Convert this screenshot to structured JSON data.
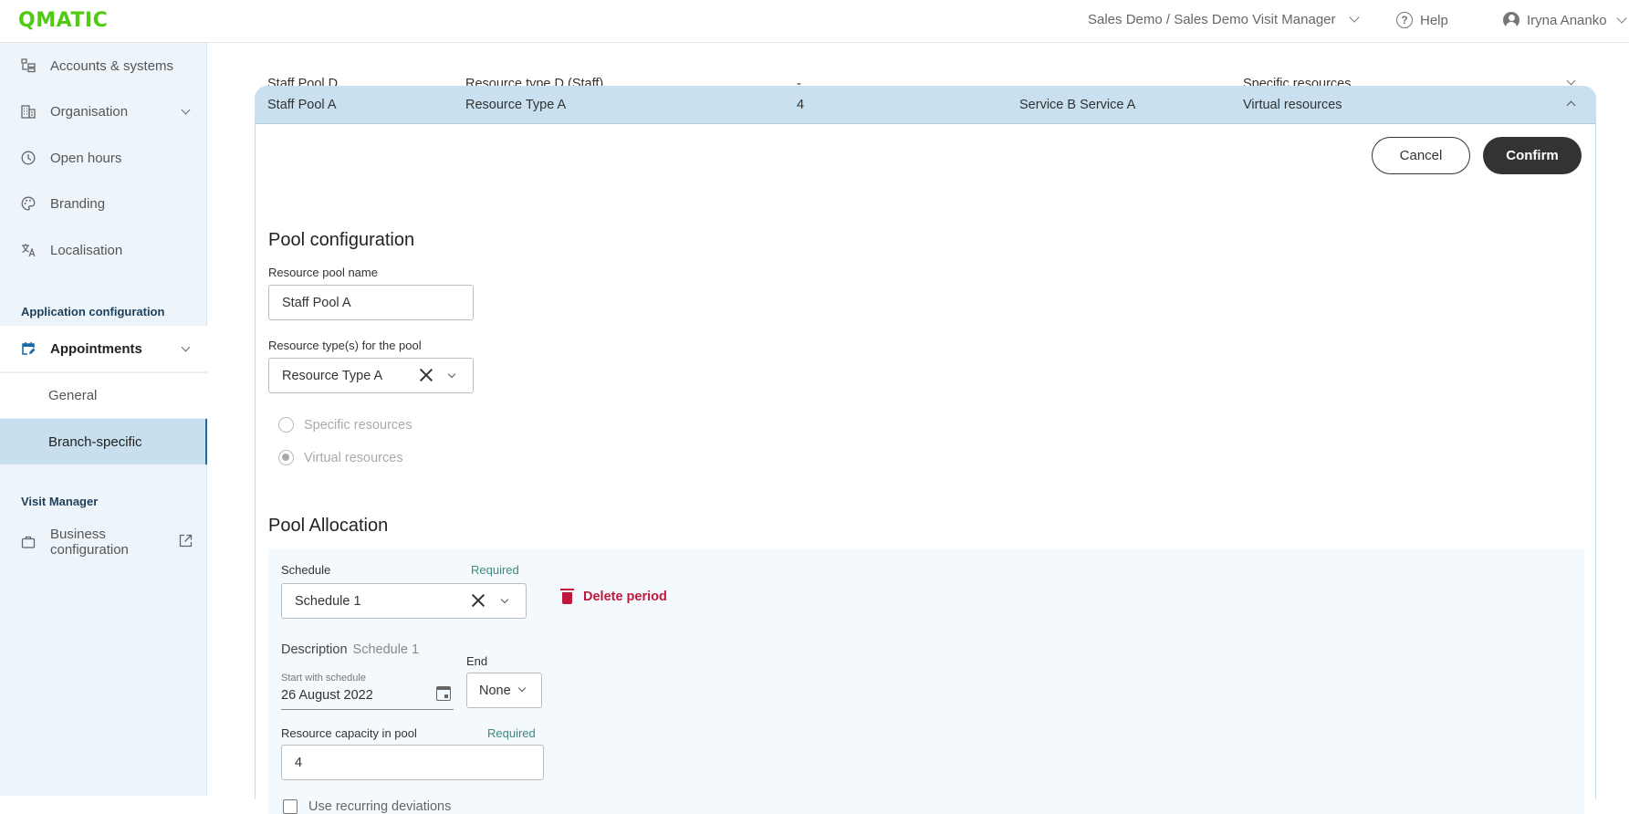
{
  "header": {
    "logo": "QMATIC",
    "breadcrumb": "Sales Demo / Sales Demo Visit Manager",
    "help_label": "Help",
    "user_name": "Iryna Ananko",
    "brand_color": "#4fcb10"
  },
  "sidebar": {
    "items": [
      {
        "label": "Accounts & systems",
        "icon": "accounts-icon"
      },
      {
        "label": "Organisation",
        "icon": "building-icon"
      },
      {
        "label": "Open hours",
        "icon": "clock-icon"
      },
      {
        "label": "Branding",
        "icon": "palette-icon"
      },
      {
        "label": "Localisation",
        "icon": "translate-icon"
      }
    ],
    "section_app": "Application configuration",
    "appointments": "Appointments",
    "sub_items": [
      {
        "label": "General"
      },
      {
        "label": "Branch-specific"
      }
    ],
    "section_vm": "Visit Manager",
    "business_config": "Business configuration"
  },
  "pools": {
    "rows": [
      {
        "name": "Staff Pool D",
        "type": "Resource type D (Staff)",
        "capacity": "-",
        "services": "",
        "mode": "Specific resources"
      },
      {
        "name": "Staff Pool A",
        "type": "Resource Type A",
        "capacity": "4",
        "services": "Service B Service A",
        "mode": "Virtual resources"
      }
    ]
  },
  "editor": {
    "cancel_label": "Cancel",
    "confirm_label": "Confirm",
    "config_title": "Pool configuration",
    "pool_name_label": "Resource pool name",
    "pool_name_value": "Staff Pool A",
    "resource_type_label": "Resource type(s) for the pool",
    "resource_type_value": "Resource Type A",
    "radio_specific": "Specific resources",
    "radio_virtual": "Virtual resources",
    "radio_selected": "Virtual resources",
    "allocation_title": "Pool Allocation",
    "schedule_label": "Schedule",
    "required_label": "Required",
    "schedule_value": "Schedule 1",
    "delete_period": "Delete period",
    "description_label": "Description",
    "description_value": "Schedule 1",
    "start_label": "Start with schedule",
    "start_value": "26 August 2022",
    "end_label": "End",
    "end_value": "None",
    "capacity_label": "Resource capacity in pool",
    "capacity_value": "4",
    "recurring_label": "Use recurring deviations",
    "recurring_checked": false
  }
}
